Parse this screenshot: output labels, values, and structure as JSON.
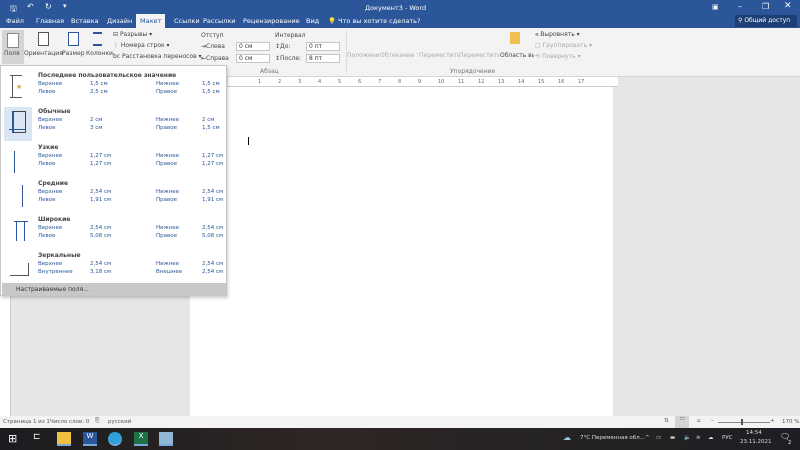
{
  "title_bar": {
    "title": "Документ3 - Word",
    "share": "Общий доступ"
  },
  "tabs": [
    "Файл",
    "Главная",
    "Вставка",
    "Дизайн",
    "Макет",
    "Ссылки",
    "Рассылки",
    "Рецензирование",
    "Вид"
  ],
  "active_tab": "Макет",
  "tell_me": "Что вы хотите сделать?",
  "ribbon": {
    "margins": "Поля",
    "orientation": "Ориентация",
    "size": "Размер",
    "columns": "Колонки",
    "breaks": "Разрывы",
    "line_numbers": "Номера строк",
    "hyphenation": "Расстановка переносов",
    "indent_label": "Отступ",
    "indent_left_label": "Слева",
    "indent_left": "0 см",
    "indent_right_label": "Справа",
    "indent_right": "0 см",
    "spacing_label": "Интервал",
    "spacing_before_label": "До:",
    "spacing_before": "0 пт",
    "spacing_after_label": "После:",
    "spacing_after": "8 пт",
    "paragraph_group": "Абзац",
    "position": "Положение",
    "wrap_text": "Обтекание текстом",
    "bring_forward": "Переместить вперед",
    "send_backward": "Переместить назад",
    "selection_pane": "Область выделения",
    "align": "Выровнять",
    "group": "Группировать",
    "rotate": "Повернуть",
    "arrange_group": "Упорядочение"
  },
  "margins_menu": {
    "options": [
      {
        "name": "Последнее пользовательское значение",
        "top_label": "Верхнее",
        "top": "1,5 см",
        "bottom_label": "Нижнее",
        "bottom": "1,5 см",
        "left_label": "Левое",
        "left": "2,5 см",
        "right_label": "Правое",
        "right": "1,5 см"
      },
      {
        "name": "Обычные",
        "top_label": "Верхнее",
        "top": "2 см",
        "bottom_label": "Нижнее",
        "bottom": "2 см",
        "left_label": "Левое",
        "left": "3 см",
        "right_label": "Правое",
        "right": "1,5 см"
      },
      {
        "name": "Узкие",
        "top_label": "Верхнее",
        "top": "1,27 см",
        "bottom_label": "Нижнее",
        "bottom": "1,27 см",
        "left_label": "Левое",
        "left": "1,27 см",
        "right_label": "Правое",
        "right": "1,27 см"
      },
      {
        "name": "Средние",
        "top_label": "Верхнее",
        "top": "2,54 см",
        "bottom_label": "Нижнее",
        "bottom": "2,54 см",
        "left_label": "Левое",
        "left": "1,91 см",
        "right_label": "Правое",
        "right": "1,91 см"
      },
      {
        "name": "Широкие",
        "top_label": "Верхнее",
        "top": "2,54 см",
        "bottom_label": "Нижнее",
        "bottom": "2,54 см",
        "left_label": "Левое",
        "left": "5,08 см",
        "right_label": "Правое",
        "right": "5,08 см"
      },
      {
        "name": "Зеркальные",
        "top_label": "Верхнее",
        "top": "2,54 см",
        "bottom_label": "Нижнее",
        "bottom": "2,54 см",
        "left_label": "Внутреннее",
        "left": "3,18 см",
        "right_label": "Внешнее",
        "right": "2,54 см"
      }
    ],
    "selected": "Обычные",
    "custom": "Настраиваемые поля..."
  },
  "ruler": [
    "1",
    "2",
    "3",
    "4",
    "5",
    "6",
    "7",
    "8",
    "9",
    "10",
    "11",
    "12",
    "13",
    "14",
    "15",
    "16",
    "17"
  ],
  "status_bar": {
    "page": "Страница 1 из 1",
    "words": "Число слов: 0",
    "language": "русский",
    "zoom": "170 %"
  },
  "taskbar": {
    "weather": "7°C Переменная обл...",
    "lang": "РУС",
    "time": "14:54",
    "date": "23.11.2021",
    "notifications": "2"
  },
  "colors": {
    "accent": "#2b579a",
    "ribbon": "#f3f3f3",
    "taskbar": "#1c1c20"
  }
}
